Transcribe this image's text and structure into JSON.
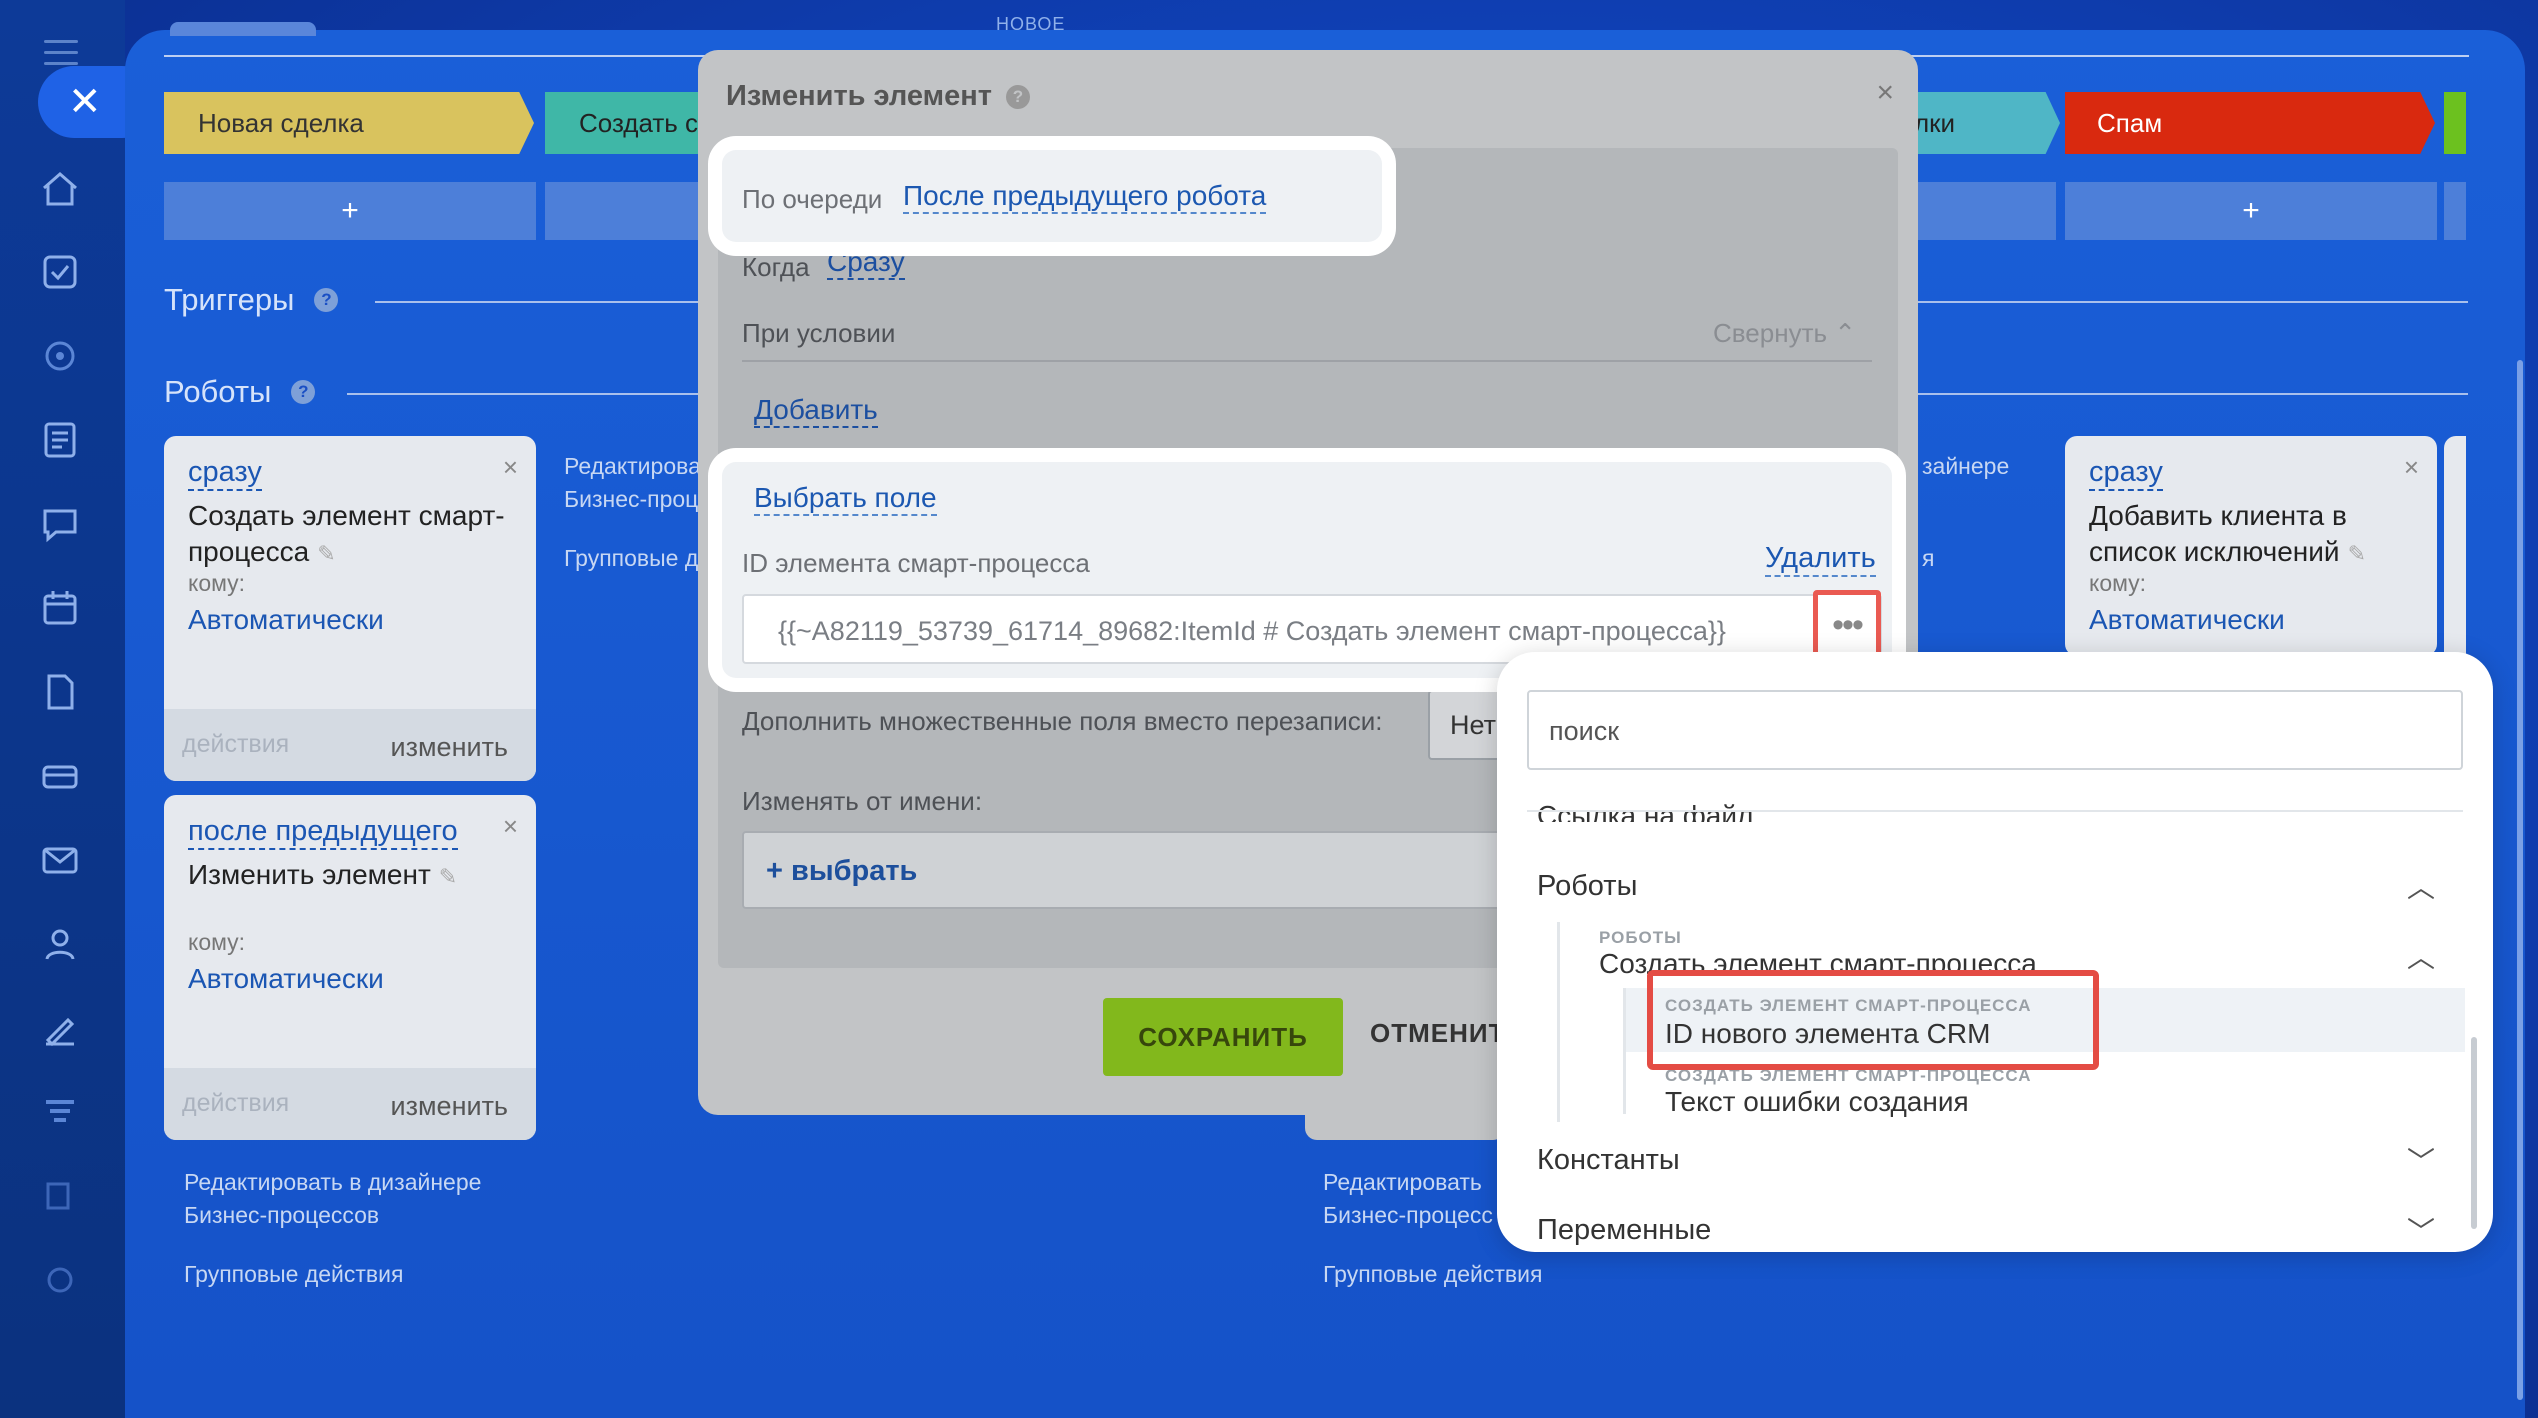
{
  "sidebar": {
    "close_label": "✕",
    "icons": [
      "home-icon",
      "tasks-icon",
      "sites-icon",
      "feed-icon",
      "chat-icon",
      "calendar-icon",
      "docs-icon",
      "crm-icon",
      "mail-icon",
      "contacts-icon",
      "marketing-icon",
      "analytics-icon",
      "knowledge-icon",
      "settings-icon"
    ]
  },
  "header": {
    "new_label": "НОВОЕ"
  },
  "stages": {
    "new_deal": "Новая сделка",
    "create": "Создать с",
    "links": "лки",
    "spam": "Спам"
  },
  "plus_label": "+",
  "sections": {
    "triggers": "Триггеры",
    "robots": "Роботы",
    "help": "?"
  },
  "cards": [
    {
      "when": "сразу",
      "title": "Создать элемент смарт-процесса",
      "to": "кому:",
      "assignee": "Автоматически",
      "actions": "действия",
      "edit": "изменить",
      "close": "×"
    },
    {
      "when": "после предыдущего",
      "title": "Изменить элемент",
      "to": "кому:",
      "assignee": "Автоматически",
      "actions": "действия",
      "edit": "изменить",
      "close": "×"
    },
    {
      "when": "сразу",
      "title": "Добавить клиента в список исключений",
      "to": "кому:",
      "assignee": "Автоматически",
      "close": "×"
    }
  ],
  "column_links": {
    "designer_partial": "Редактирова",
    "bp_partial": "Бизнес-проц",
    "group_partial": "Групповые д",
    "designer": "Редактировать в дизайнере",
    "bp": "Бизнес-процессов",
    "group": "Групповые действия",
    "designer2": "Редактировать",
    "bp2": "Бизнес-процесс",
    "right_designer_partial": "зайнере",
    "right_ya": "я"
  },
  "dialog": {
    "title": "Изменить элемент",
    "help": "?",
    "close": "×",
    "order_label": "По очереди",
    "order_value": "После предыдущего робота",
    "when_label": "Когда",
    "when_value": "Сразу",
    "condition_label": "При условии",
    "collapse": "Свернуть",
    "add": "Добавить",
    "choose_field": "Выбрать поле",
    "field_label": "ID элемента смарт-процесса",
    "delete": "Удалить",
    "field_value": "{{~A82119_53739_61714_89682:ItemId # Создать элемент смарт-процесса}}",
    "dots": "•••",
    "append_label": "Дополнить множественные поля вместо перезаписи:",
    "append_value": "Нет",
    "as_user_label": "Изменять от имени:",
    "choose_btn": "+ выбрать",
    "save": "СОХРАНИТЬ",
    "cancel": "ОТМЕНИТЬ"
  },
  "picker": {
    "search_placeholder": "поиск",
    "cut_item": "Ссылка на файл",
    "robots_group": "Роботы",
    "subgroup_caption": "РОБОТЫ",
    "subgroup_title": "Создать элемент смарт-процесса",
    "item1_caption": "СОЗДАТЬ ЭЛЕМЕНТ СМАРТ-ПРОЦЕССА",
    "item1": "ID нового элемента CRM",
    "item2_caption": "СОЗДАТЬ ЭЛЕМЕНТ СМАРТ-ПРОЦЕССА",
    "item2": "Текст ошибки создания",
    "constants": "Константы",
    "variables": "Переменные"
  },
  "colors": {
    "accent": "#1b56b3",
    "save_green": "#82b81c",
    "highlight_red": "#e44c44",
    "spam_red": "#d9290f"
  }
}
